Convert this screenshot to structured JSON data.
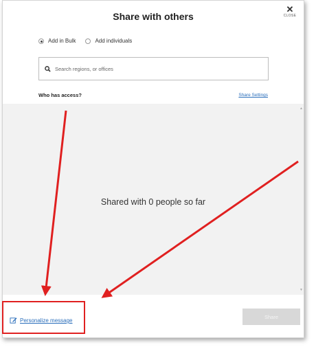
{
  "dialog": {
    "title": "Share with others",
    "close": {
      "symbol": "✕",
      "label": "CLOSE"
    }
  },
  "mode": {
    "options": [
      {
        "label": "Add in Bulk",
        "selected": true
      },
      {
        "label": "Add individuals",
        "selected": false
      }
    ]
  },
  "search": {
    "placeholder": "Search regions, or offices",
    "value": ""
  },
  "access": {
    "heading": "Who has access?",
    "settings_link": "Share Settings",
    "empty_message": "Shared with 0 people so far"
  },
  "footer": {
    "personalize_label": "Personalize message",
    "share_label": "Share",
    "share_enabled": false
  },
  "annotations": {
    "color": "#e02020"
  },
  "icons": [
    "close-icon",
    "search-icon",
    "edit-icon"
  ]
}
